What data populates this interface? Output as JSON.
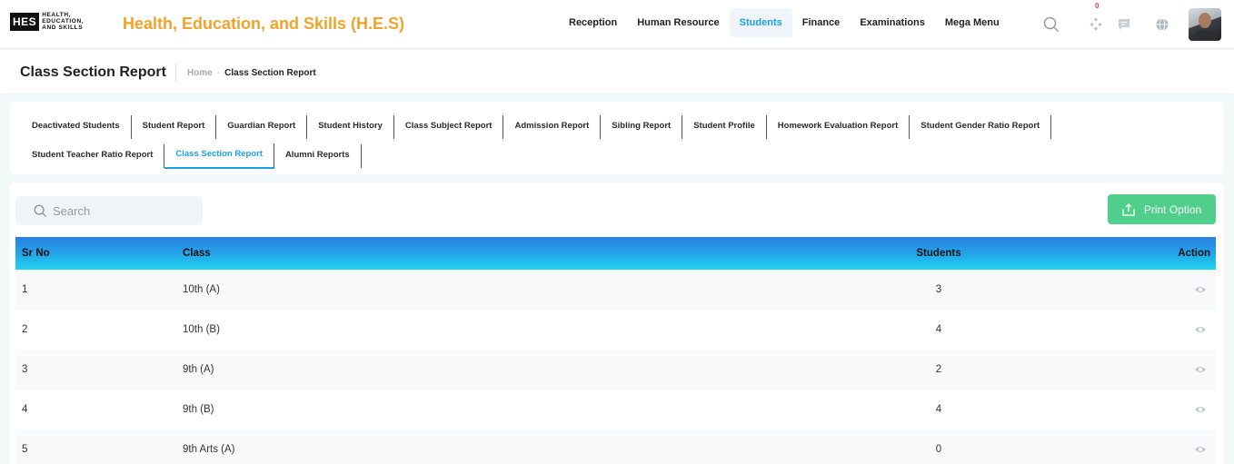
{
  "logo": {
    "mark": "HES",
    "line1": "HEALTH,",
    "line2": "EDUCATION,",
    "line3": "AND SKILLS"
  },
  "app_title": "Health, Education, and Skills (H.E.S)",
  "nav": [
    {
      "label": "Reception",
      "active": false
    },
    {
      "label": "Human Resource",
      "active": false
    },
    {
      "label": "Students",
      "active": true
    },
    {
      "label": "Finance",
      "active": false
    },
    {
      "label": "Examinations",
      "active": false
    },
    {
      "label": "Mega Menu",
      "active": false
    }
  ],
  "top_icons": [
    "search-icon",
    "apps-icon",
    "chat-icon",
    "globe-icon"
  ],
  "notification_count": "0",
  "page": {
    "title": "Class Section Report",
    "breadcrumb_home": "Home",
    "breadcrumb_sep": "-",
    "breadcrumb_current": "Class Section Report"
  },
  "tabs_row1": [
    "Deactivated Students",
    "Student Report",
    "Guardian Report",
    "Student History",
    "Class Subject Report",
    "Admission Report",
    "Sibling Report",
    "Student Profile",
    "Homework Evaluation Report",
    "Student Gender Ratio Report"
  ],
  "tabs_row2": [
    "Student Teacher Ratio Report",
    "Class Section Report",
    "Alumni Reports"
  ],
  "active_tab": "Class Section Report",
  "search": {
    "placeholder": "Search"
  },
  "print_button": "Print Option",
  "table": {
    "headers": {
      "sr": "Sr No",
      "class": "Class",
      "students": "Students",
      "action": "Action"
    },
    "rows": [
      {
        "sr": "1",
        "class": "10th (A)",
        "students": "3"
      },
      {
        "sr": "2",
        "class": "10th (B)",
        "students": "4"
      },
      {
        "sr": "3",
        "class": "9th (A)",
        "students": "2"
      },
      {
        "sr": "4",
        "class": "9th (B)",
        "students": "4"
      },
      {
        "sr": "5",
        "class": "9th Arts (A)",
        "students": "0"
      }
    ]
  },
  "colors": {
    "brand": "#f1a22a",
    "accent": "#1e9ee5",
    "print_button": "#4fcf8a",
    "header_gradient_start": "#2c7fe4",
    "header_gradient_end": "#22d3f1"
  }
}
